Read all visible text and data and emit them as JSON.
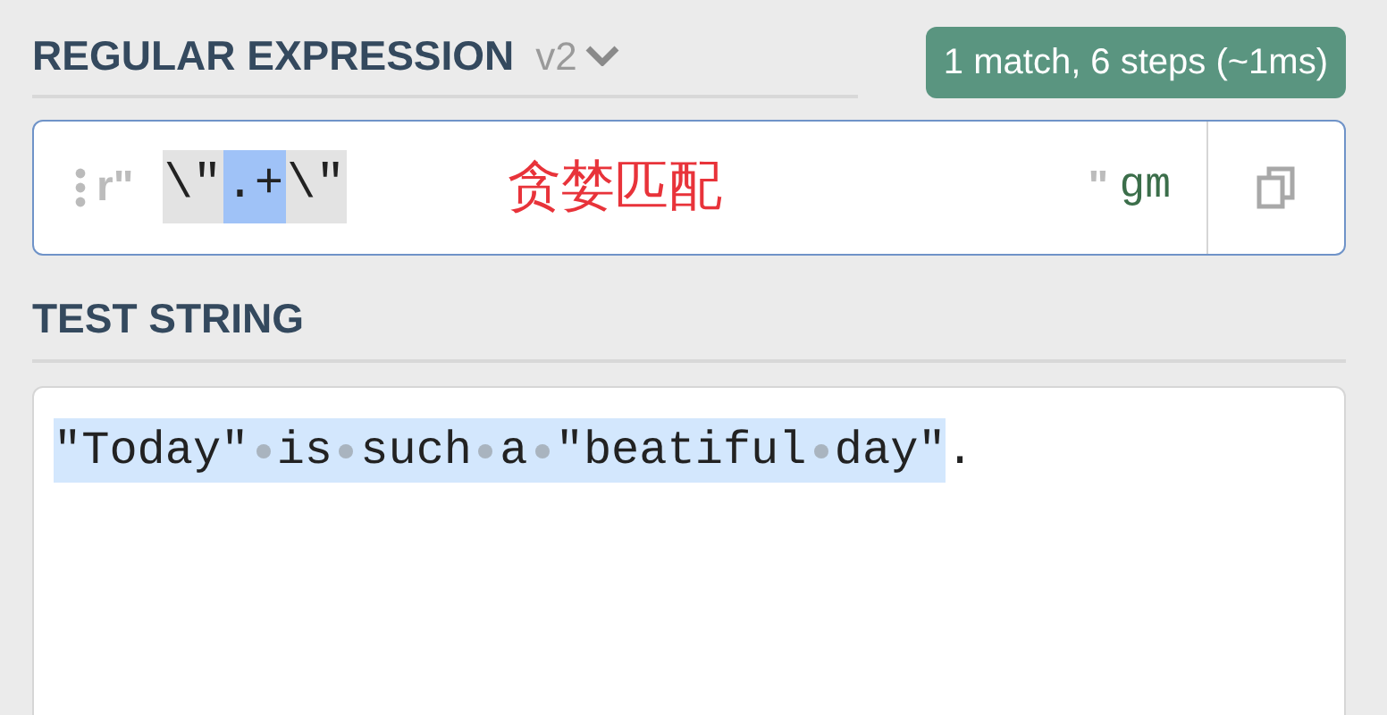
{
  "regex_header": {
    "title": "REGULAR EXPRESSION",
    "version": "v2",
    "match_info": "1 match, 6 steps (~1ms)"
  },
  "regex": {
    "prefix": "r\"",
    "tokens": [
      {
        "text": "\\\"",
        "kind": "escape"
      },
      {
        "text": ".+",
        "kind": "quantified"
      },
      {
        "text": "\\\"",
        "kind": "escape"
      }
    ],
    "annotation": "贪婪匹配",
    "suffix": "\"",
    "flags": "gm"
  },
  "test_header": {
    "title": "TEST STRING"
  },
  "test_string": {
    "segments": [
      {
        "text": "\"Today\" is such a \"beatiful day\"",
        "matched": true
      },
      {
        "text": ".",
        "matched": false
      }
    ]
  }
}
